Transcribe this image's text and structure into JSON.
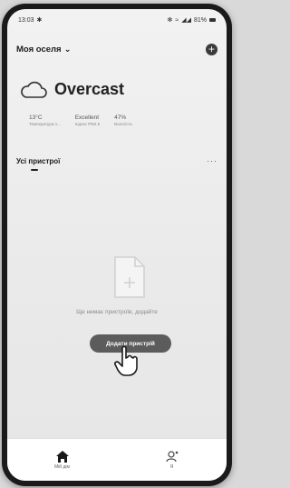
{
  "status_bar": {
    "time": "13:03",
    "battery": "81%"
  },
  "header": {
    "home_name": "Моя оселя"
  },
  "weather": {
    "condition": "Overcast",
    "temperature": {
      "value": "13°C",
      "label": "Температура п..."
    },
    "pm25": {
      "value": "Excellent",
      "label": "Індекс PM2.5"
    },
    "humidity": {
      "value": "47%",
      "label": "Вологість"
    }
  },
  "devices": {
    "section_title": "Усі пристрої",
    "empty_message": "Ще немає пристроїв, додайте",
    "add_device_label": "Додати пристрій"
  },
  "tabbar": {
    "tabs": [
      {
        "label": "Мій дім",
        "icon": "home-icon"
      },
      {
        "label": "Я",
        "icon": "profile-icon"
      }
    ]
  }
}
